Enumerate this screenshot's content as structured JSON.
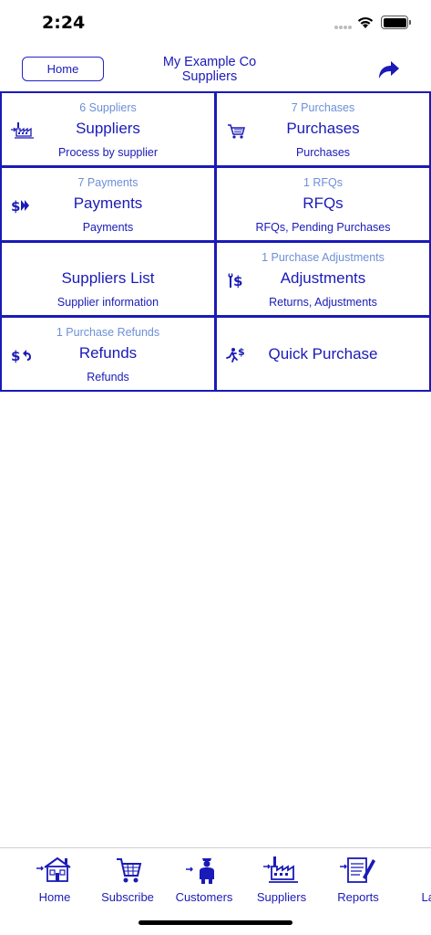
{
  "status_bar": {
    "time": "2:24"
  },
  "header": {
    "home_button": "Home",
    "company": "My Example Co",
    "section": "Suppliers",
    "share_icon": "share-arrow-icon"
  },
  "colors": {
    "accent": "#1a1ab8",
    "count": "#6d8fd8",
    "border": "#1a1ab8"
  },
  "tiles": [
    {
      "count": "6 Suppliers",
      "title": "Suppliers",
      "subtitle": "Process by supplier",
      "icon": "factory-icon"
    },
    {
      "count": "7 Purchases",
      "title": "Purchases",
      "subtitle": "Purchases",
      "icon": "cart-icon"
    },
    {
      "count": "7 Payments",
      "title": "Payments",
      "subtitle": "Payments",
      "icon": "payment-icon"
    },
    {
      "count": "1 RFQs",
      "title": "RFQs",
      "subtitle": "RFQs, Pending Purchases",
      "icon": ""
    },
    {
      "count": "",
      "title": "Suppliers List",
      "subtitle": "Supplier information",
      "icon": ""
    },
    {
      "count": "1 Purchase Adjustments",
      "title": "Adjustments",
      "subtitle": "Returns, Adjustments",
      "icon": "wrench-dollar-icon"
    },
    {
      "count": "1 Purchase Refunds",
      "title": "Refunds",
      "subtitle": "Refunds",
      "icon": "refund-icon"
    },
    {
      "count": "",
      "title": "Quick Purchase",
      "subtitle": "",
      "icon": "running-dollar-icon"
    }
  ],
  "tab_bar": [
    {
      "label": "Home",
      "icon": "house-icon"
    },
    {
      "label": "Subscribe",
      "icon": "cart-icon"
    },
    {
      "label": "Customers",
      "icon": "customer-icon"
    },
    {
      "label": "Suppliers",
      "icon": "factory-icon"
    },
    {
      "label": "Reports",
      "icon": "report-icon"
    },
    {
      "label": "Laun",
      "icon": "launch-icon"
    }
  ]
}
